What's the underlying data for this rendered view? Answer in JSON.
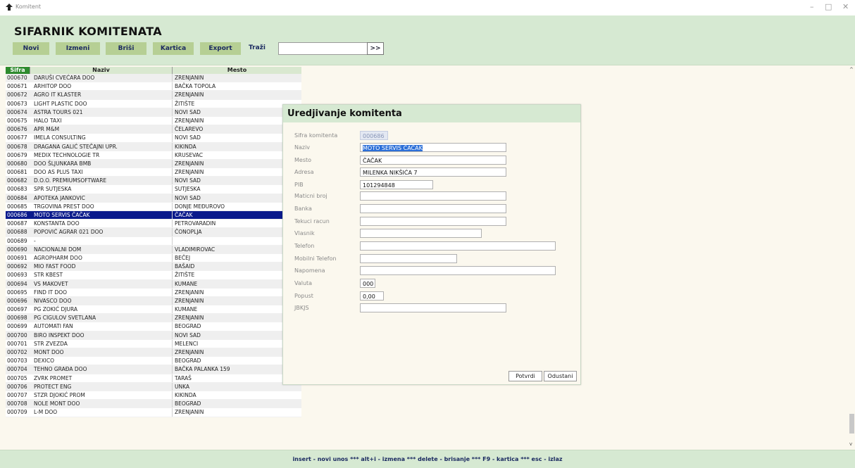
{
  "window": {
    "title": "Komitent"
  },
  "header": {
    "title": "SIFARNIK KOMITENATA"
  },
  "toolbar": {
    "novi": "Novi",
    "izmeni": "Izmeni",
    "brisi": "Briši",
    "kartica": "Kartica",
    "export": "Export",
    "search_label": "Traži",
    "search_value": "",
    "search_go": ">>"
  },
  "grid": {
    "columns": [
      "Sifra",
      "Naziv",
      "Mesto"
    ],
    "rows": [
      [
        "000670",
        "DARUŠI CVEĆARA DOO",
        "ZRENJANIN"
      ],
      [
        "000671",
        "ARHITOP DOO",
        "BAČKA TOPOLA"
      ],
      [
        "000672",
        "AGRO IT KLASTER",
        "ZRENJANIN"
      ],
      [
        "000673",
        "LIGHT PLASTIC DOO",
        "ŽITIŠTE"
      ],
      [
        "000674",
        "ASTRA TOURS 021",
        "NOVI SAD"
      ],
      [
        "000675",
        "HALO TAXI",
        "ZRENJANIN"
      ],
      [
        "000676",
        "APR M&M",
        "ČELAREVO"
      ],
      [
        "000677",
        "IMELA CONSULTING",
        "NOVI SAD"
      ],
      [
        "000678",
        "DRAGANA GALIĆ STEČAJNI UPR.",
        "KIKINDA"
      ],
      [
        "000679",
        "MEDIX TECHNOLOGIE TR",
        "KRUSEVAC"
      ],
      [
        "000680",
        "DOO ŠLJUNKARA BMB",
        "ZRENJANIN"
      ],
      [
        "000681",
        "DOO AS PLUS TAXI",
        "ZRENJANIN"
      ],
      [
        "000682",
        "D.O.O. PREMIUMSOFTWARE",
        "NOVI SAD"
      ],
      [
        "000683",
        "SPR SUTJESKA",
        "SUTJESKA"
      ],
      [
        "000684",
        "APOTEKA JANKOVIC",
        "NOVI SAD"
      ],
      [
        "000685",
        "TRGOVINA PREST DOO",
        "DONJE MEĐUROVO"
      ],
      [
        "000686",
        "MOTO SERVIS ČAČAK",
        "ČAČAK"
      ],
      [
        "000687",
        "KONSTANTA DOO",
        "PETROVARADIN"
      ],
      [
        "000688",
        "POPOVIĆ AGRAR 021 DOO",
        "ČONOPLJA"
      ],
      [
        "000689",
        "-",
        ""
      ],
      [
        "000690",
        "NACIONALNI DOM",
        "VLADIMIROVAC"
      ],
      [
        "000691",
        "AGROPHARM DOO",
        "BEČEJ"
      ],
      [
        "000692",
        "MIO FAST FOOD",
        "BAŠAID"
      ],
      [
        "000693",
        "STR KBEST",
        "ŽITIŠTE"
      ],
      [
        "000694",
        "VS MAKOVET",
        "KUMANE"
      ],
      [
        "000695",
        "FIND IT DOO",
        "ZRENJANIN"
      ],
      [
        "000696",
        "NIVASCO DOO",
        "ZRENJANIN"
      ],
      [
        "000697",
        "PG ZOKIĆ DJURA",
        "KUMANE"
      ],
      [
        "000698",
        "PG CIGULOV SVETLANA",
        "ZRENJANIN"
      ],
      [
        "000699",
        "AUTOMATI FAN",
        "BEOGRAD"
      ],
      [
        "000700",
        "BIRO INSPEKT DOO",
        "NOVI SAD"
      ],
      [
        "000701",
        "STR ZVEZDA",
        "MELENCI"
      ],
      [
        "000702",
        "MONT DOO",
        "ZRENJANIN"
      ],
      [
        "000703",
        "DEXICO",
        "BEOGRAD"
      ],
      [
        "000704",
        "TEHNO GRAĐA DOO",
        "BAČKA PALANKA 159"
      ],
      [
        "000705",
        "ZVRK PROMET",
        "TARAŠ"
      ],
      [
        "000706",
        "PROTECT ENG",
        "UNKA"
      ],
      [
        "000707",
        "STZR DJOKIĆ PROM",
        "KIKINDA"
      ],
      [
        "000708",
        "NOLE MONT DOO",
        "BEOGRAD"
      ],
      [
        "000709",
        "L-M DOO",
        "ZRENJANIN"
      ]
    ],
    "selected_index": 16
  },
  "dialog": {
    "title": "Uredjivanje komitenta",
    "fields": [
      {
        "label": "Sifra komitenta",
        "value": "000686"
      },
      {
        "label": "Naziv",
        "value": "MOTO SERVIS ČAČAK"
      },
      {
        "label": "Mesto",
        "value": "ČAČAK"
      },
      {
        "label": "Adresa",
        "value": "MILENKA NIKŠIĆA 7"
      },
      {
        "label": "PIB",
        "value": "101294848"
      },
      {
        "label": "Maticni broj",
        "value": ""
      },
      {
        "label": "Banka",
        "value": ""
      },
      {
        "label": "Tekuci racun",
        "value": ""
      },
      {
        "label": "Vlasnik",
        "value": ""
      },
      {
        "label": "Telefon",
        "value": ""
      },
      {
        "label": "Mobilni Telefon",
        "value": ""
      },
      {
        "label": "Napomena",
        "value": ""
      },
      {
        "label": "Valuta",
        "value": "000"
      },
      {
        "label": "Popust",
        "value": "0,00"
      },
      {
        "label": "JBKJS",
        "value": ""
      }
    ],
    "confirm": "Potvrdi",
    "cancel": "Odustani"
  },
  "footer": {
    "hint": "insert - novi unos  ***  alt+i - izmena  ***  delete - brisanje  ***  F9 - kartica *** esc - izlaz"
  },
  "colors": {
    "header_bg": "#d6e9d2",
    "button_bg": "#b6cf94",
    "selection": "#0a1a8c",
    "body_bg": "#fbf8ee",
    "sifra_header": "#2e8b2e"
  }
}
